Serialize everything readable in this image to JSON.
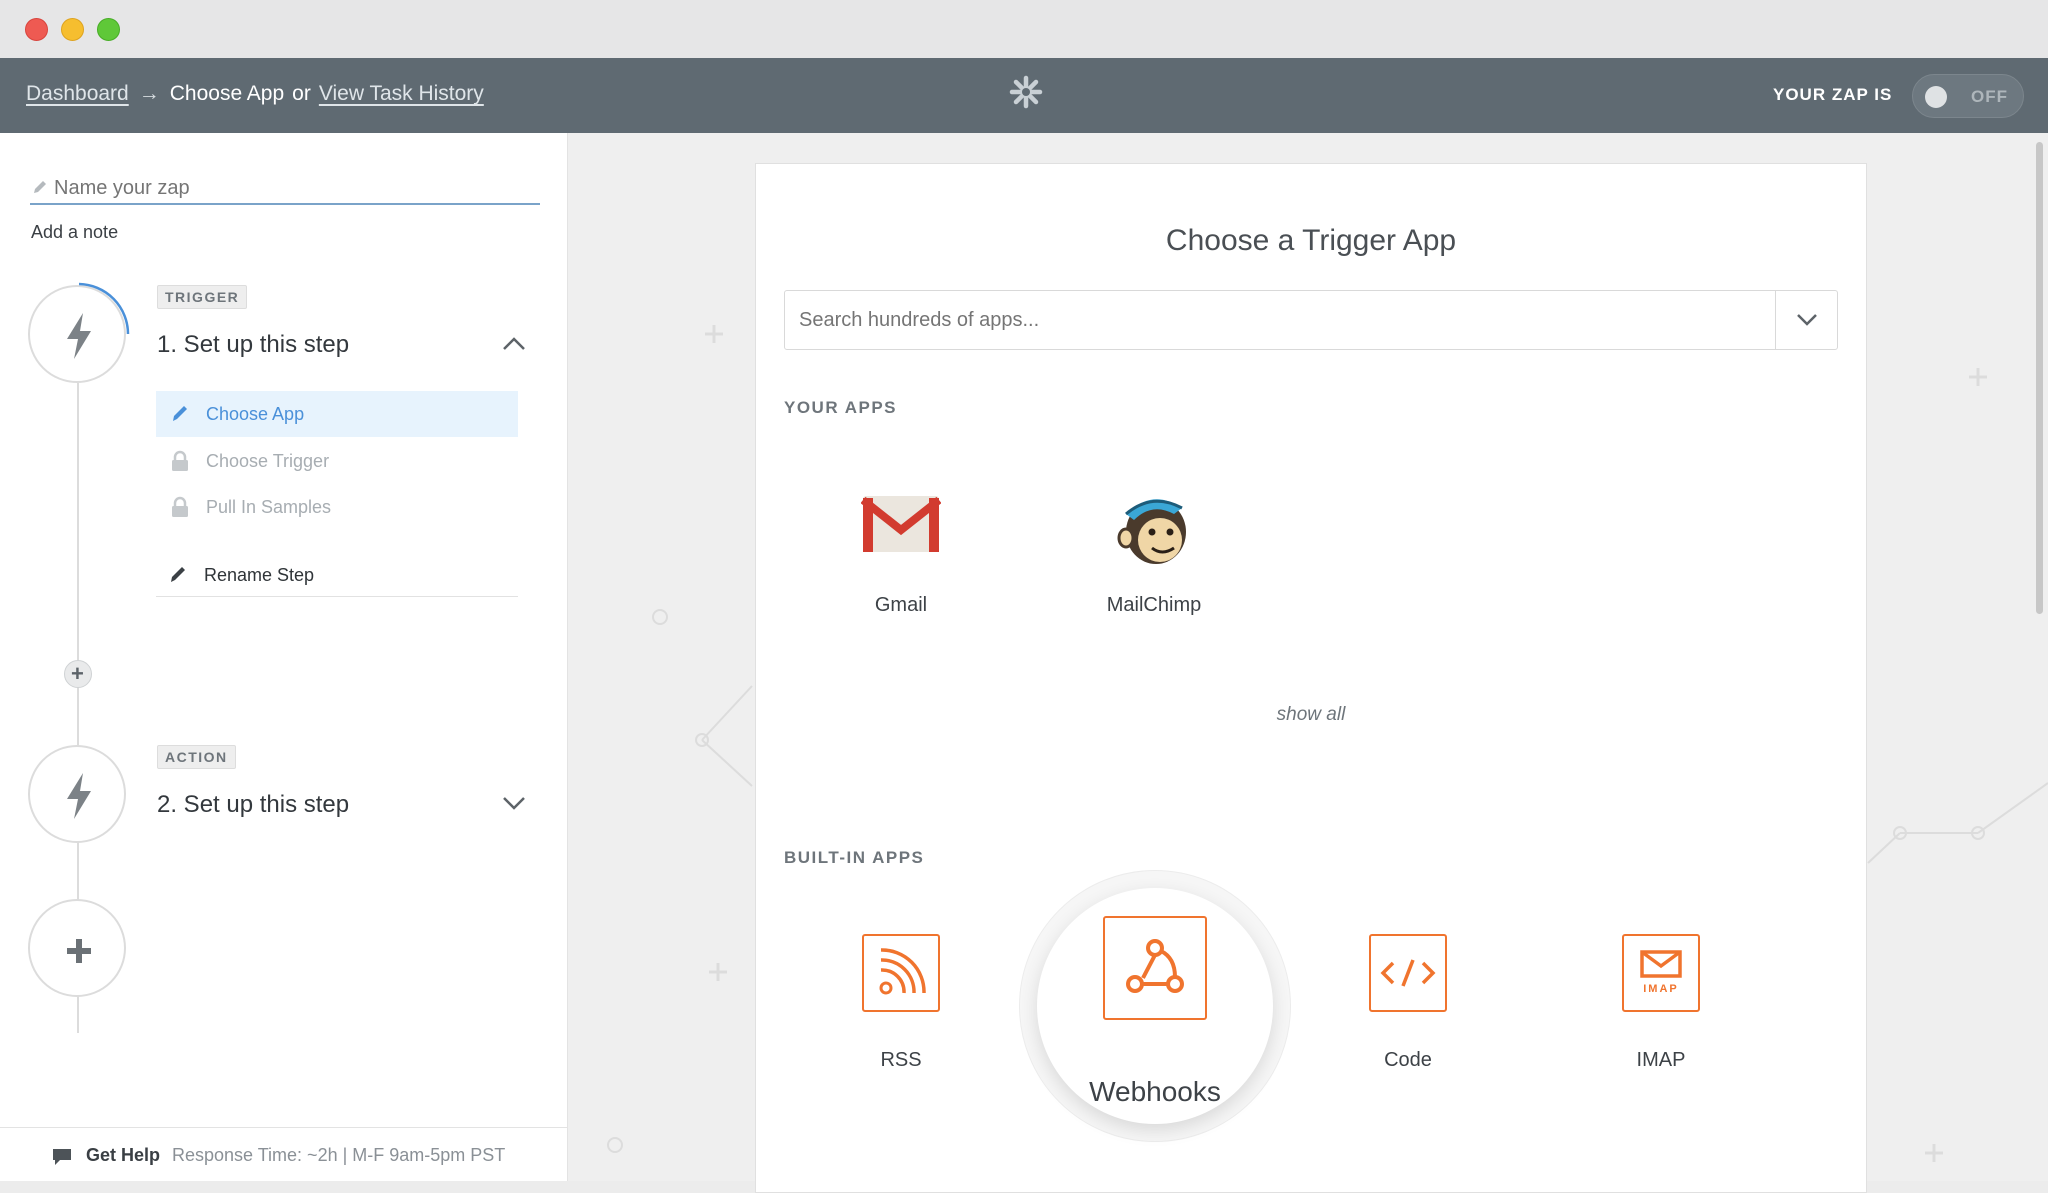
{
  "window": {
    "controls": [
      "close",
      "minimize",
      "maximize"
    ]
  },
  "topbar": {
    "dashboard": "Dashboard",
    "arrow": "→",
    "current": "Choose App",
    "or": "or",
    "history": "View Task History",
    "zap_status_label": "YOUR ZAP IS",
    "toggle_state": "OFF",
    "logo_icon": "zapier-asterisk-icon"
  },
  "sidebar": {
    "name_placeholder": "Name your zap",
    "add_note": "Add a note",
    "trigger": {
      "badge": "TRIGGER",
      "title": "1. Set up this step",
      "substeps": [
        {
          "label": "Choose App",
          "state": "active",
          "icon": "pencil-icon"
        },
        {
          "label": "Choose Trigger",
          "state": "locked",
          "icon": "lock-icon"
        },
        {
          "label": "Pull In Samples",
          "state": "locked",
          "icon": "lock-icon"
        }
      ],
      "rename": "Rename Step"
    },
    "action": {
      "badge": "ACTION",
      "title": "2. Set up this step"
    },
    "help": {
      "label": "Get Help",
      "response": "Response Time: ~2h | M-F 9am-5pm PST"
    }
  },
  "main": {
    "title": "Choose a Trigger App",
    "search_placeholder": "Search hundreds of apps...",
    "your_apps_label": "YOUR APPS",
    "your_apps": [
      {
        "name": "Gmail",
        "icon": "gmail-icon"
      },
      {
        "name": "MailChimp",
        "icon": "mailchimp-icon"
      }
    ],
    "show_all": "show all",
    "built_in_label": "BUILT-IN APPS",
    "built_in": [
      {
        "name": "RSS",
        "icon": "rss-icon"
      },
      {
        "name": "Webhooks",
        "icon": "webhooks-icon"
      },
      {
        "name": "Code",
        "icon": "code-icon"
      },
      {
        "name": "IMAP",
        "icon": "imap-icon",
        "icon_text": "IMAP"
      }
    ]
  },
  "colors": {
    "topbar": "#5f6a72",
    "accent_orange": "#f0742e",
    "active_blue": "#4a90d9",
    "active_bg": "#e7f3fd"
  }
}
